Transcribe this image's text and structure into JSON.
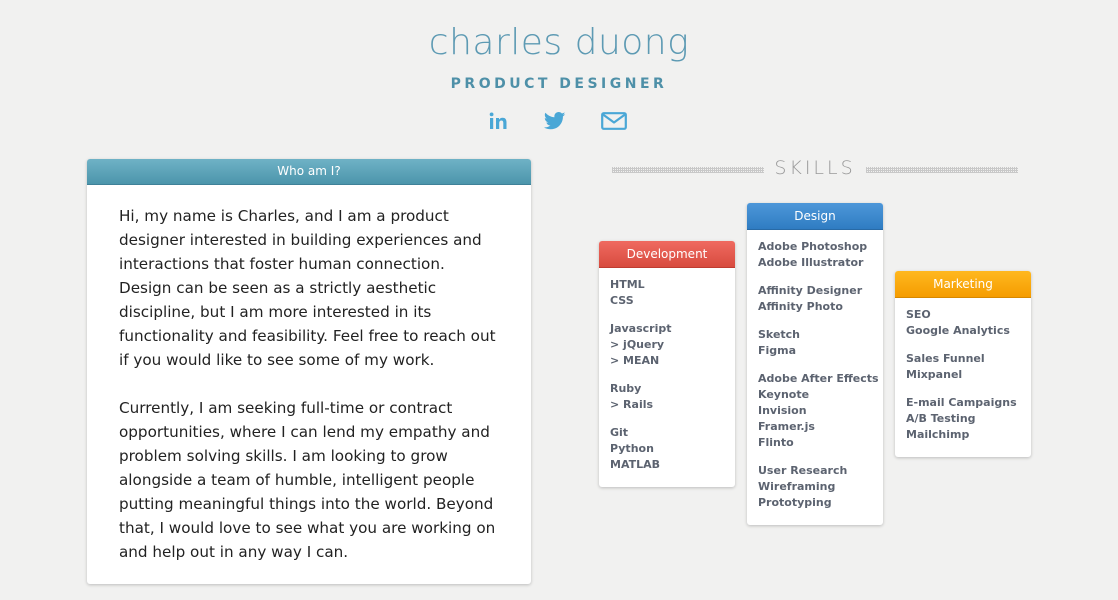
{
  "header": {
    "name": "charles duong",
    "title": "PRODUCT DESIGNER",
    "social": [
      {
        "name": "linkedin-icon",
        "label": "in"
      },
      {
        "name": "twitter-icon",
        "label": "twitter"
      },
      {
        "name": "mail-icon",
        "label": "mail"
      }
    ]
  },
  "about": {
    "heading": "Who am I?",
    "paragraphs": [
      "Hi, my name is Charles, and I am a product designer interested in building experiences and interactions that foster human connection. Design can be seen as a strictly aesthetic discipline, but I am more interested in its functionality and feasibility. Feel free to reach out if you would like to see some of my work.",
      "Currently, I am seeking full-time or contract opportunities, where I can lend my empathy and problem solving skills. I am looking to grow alongside a team of humble, intelligent people putting meaningful things into the world. Beyond that, I would love to see what you are working on and help out in any way I can."
    ]
  },
  "skills": {
    "heading": "SKILLS",
    "cards": [
      {
        "title": "Development",
        "color": "#e25a4e",
        "groups": [
          [
            "HTML",
            "CSS"
          ],
          [
            "Javascript",
            "> jQuery",
            "> MEAN"
          ],
          [
            "Ruby",
            "> Rails"
          ],
          [
            "Git",
            "Python",
            "MATLAB"
          ]
        ]
      },
      {
        "title": "Design",
        "color": "#3b89cc",
        "groups": [
          [
            "Adobe Photoshop",
            "Adobe Illustrator"
          ],
          [
            "Affinity Designer",
            "Affinity Photo"
          ],
          [
            "Sketch",
            "Figma"
          ],
          [
            "Adobe After Effects",
            "Keynote",
            "Invision",
            "Framer.js",
            "Flinto"
          ],
          [
            "User Research",
            "Wireframing",
            "Prototyping"
          ]
        ]
      },
      {
        "title": "Marketing",
        "color": "#f8a70d",
        "groups": [
          [
            "SEO",
            "Google Analytics"
          ],
          [
            "Sales Funnel",
            "Mixpanel"
          ],
          [
            "E-mail Campaigns",
            "A/B Testing",
            "Mailchimp"
          ]
        ]
      }
    ]
  },
  "colors": {
    "background": "#f1f1f0",
    "accent": "#5d9ab3",
    "icon": "#4aa7d6"
  }
}
